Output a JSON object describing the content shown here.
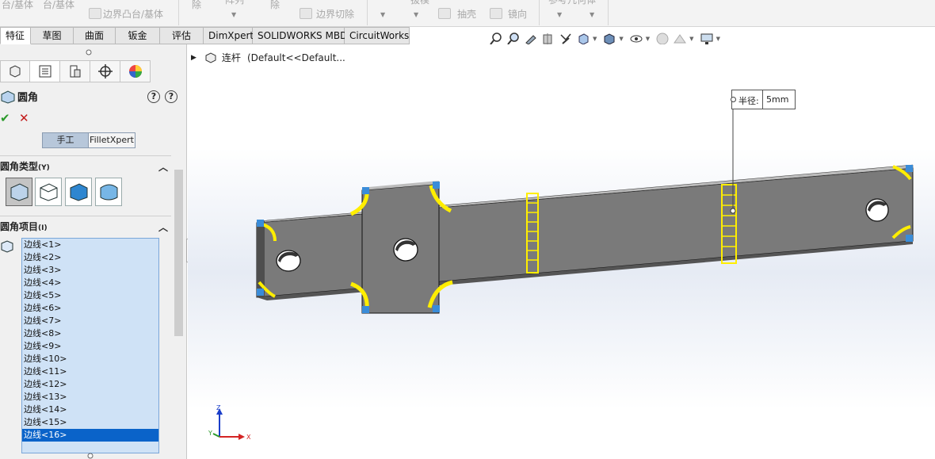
{
  "ribbon": {
    "items": [
      "台/基体",
      "台/基体",
      "边界凸台/基体",
      "除",
      "阵列",
      "除",
      "边界切除",
      "拔模",
      "抽壳",
      "镜向",
      "参考几何体"
    ]
  },
  "tabs": [
    {
      "label": "特征",
      "active": true
    },
    {
      "label": "草图",
      "active": false
    },
    {
      "label": "曲面",
      "active": false
    },
    {
      "label": "钣金",
      "active": false
    },
    {
      "label": "评估",
      "active": false
    },
    {
      "label": "DimXpert",
      "active": false
    },
    {
      "label": "SOLIDWORKS MBD",
      "active": false
    },
    {
      "label": "CircuitWorks",
      "active": false
    }
  ],
  "hud_icons": [
    "zoom-to-fit-icon",
    "zoom-area-icon",
    "previous-view-icon",
    "section-view-icon",
    "dynamic-annotation-icon",
    "view-orientation-icon",
    "display-style-icon",
    "hide-show-items-icon",
    "edit-appearance-icon",
    "apply-scene-icon",
    "view-settings-icon"
  ],
  "property_manager": {
    "panel_tabs": [
      "feature-manager-icon",
      "property-manager-icon",
      "configuration-manager-icon",
      "dimxpert-manager-icon",
      "display-manager-icon"
    ],
    "title": "圆角",
    "help": "?",
    "ok": "✔",
    "cancel": "✕",
    "mode_manual": "手工",
    "mode_xpert": "FilletXpert",
    "section_type": "圆角类型",
    "section_type_suffix": "(Y)",
    "section_items": "圆角项目",
    "section_items_suffix": "(I)",
    "fillet_types": [
      "constant-size-fillet-icon",
      "variable-size-fillet-icon",
      "face-fillet-icon",
      "full-round-fillet-icon"
    ],
    "edges": [
      "边线<1>",
      "边线<2>",
      "边线<3>",
      "边线<4>",
      "边线<5>",
      "边线<6>",
      "边线<7>",
      "边线<8>",
      "边线<9>",
      "边线<10>",
      "边线<11>",
      "边线<12>",
      "边线<13>",
      "边线<14>",
      "边线<15>",
      "边线<16>"
    ],
    "selected_edge_index": 15
  },
  "graphics": {
    "tree_label": "连杆",
    "tree_config": "(Default<<Default...",
    "callout_label": "半径:",
    "callout_value": "5mm",
    "triad": {
      "x": "X",
      "y": "Y",
      "z": "Z"
    },
    "colors": {
      "part": "#7a7a7a",
      "fillet_preview": "#ffee00",
      "selected_edge": "#0a63c9"
    }
  }
}
